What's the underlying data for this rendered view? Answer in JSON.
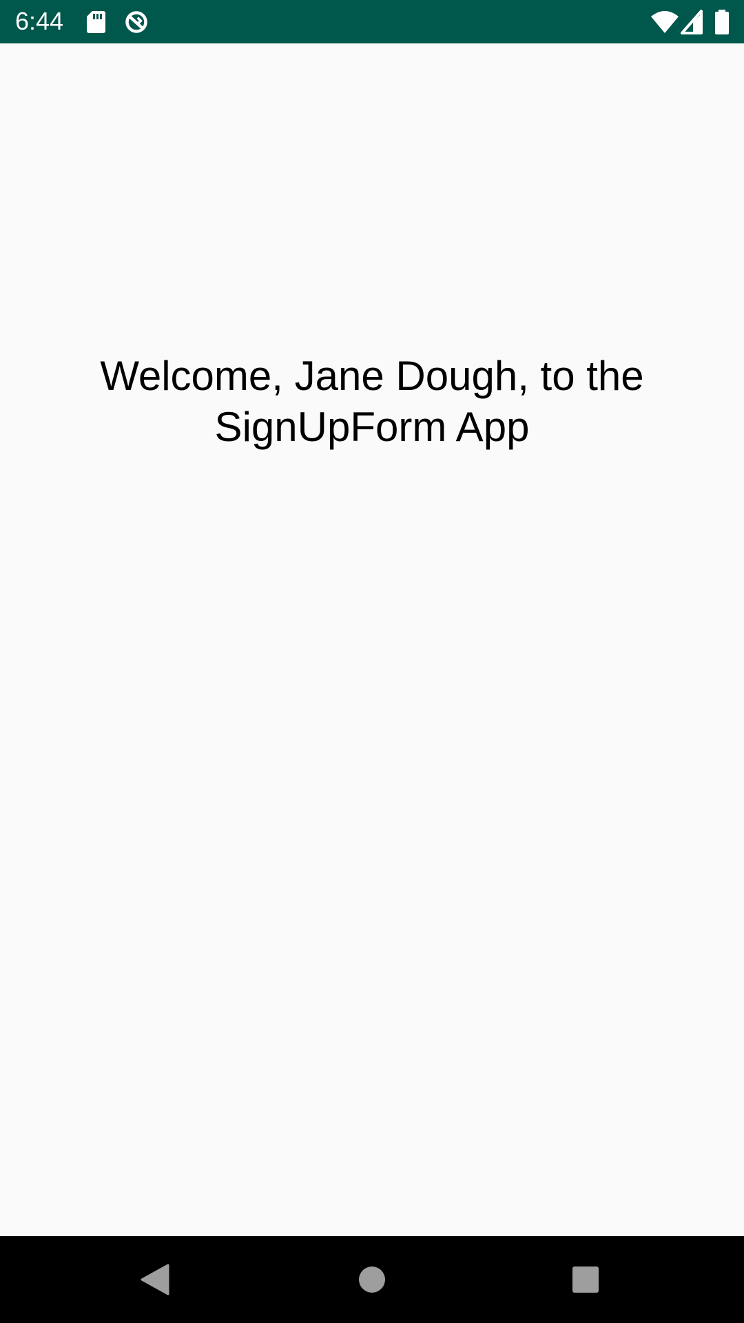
{
  "status_bar": {
    "time": "6:44",
    "background_color": "#00574b",
    "icons_left": [
      "sd-card-icon",
      "sync-icon"
    ],
    "icons_right": [
      "wifi-icon",
      "cell-signal-icon",
      "battery-icon"
    ]
  },
  "main": {
    "welcome_message": "Welcome, Jane Dough, to the SignUpForm App",
    "background_color": "#fafafa"
  },
  "nav_bar": {
    "buttons": [
      "back-icon",
      "home-icon",
      "recents-icon"
    ],
    "background_color": "#000000"
  }
}
